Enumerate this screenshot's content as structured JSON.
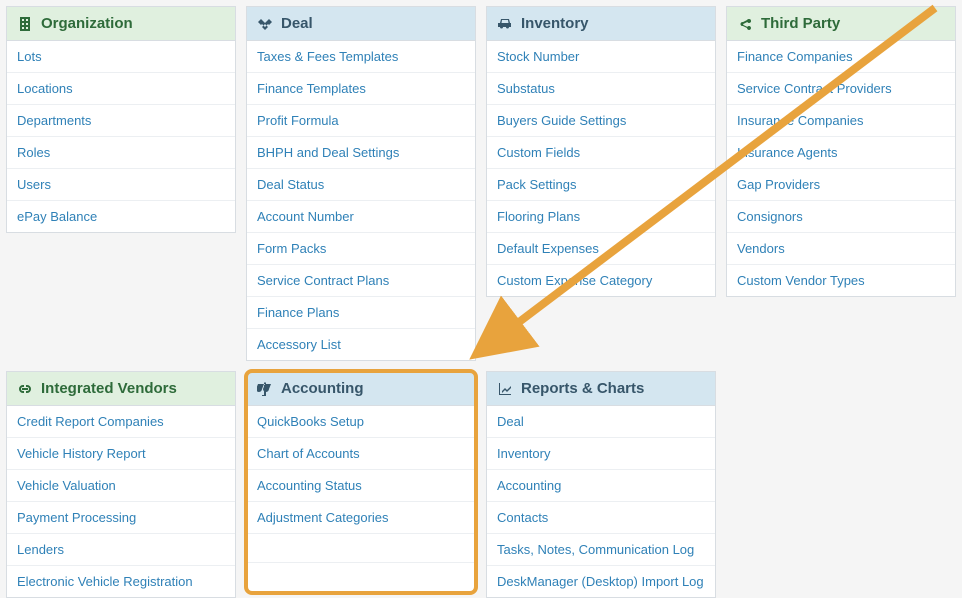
{
  "panels": {
    "organization": {
      "title": "Organization",
      "items": [
        "Lots",
        "Locations",
        "Departments",
        "Roles",
        "Users",
        "ePay Balance"
      ]
    },
    "deal": {
      "title": "Deal",
      "items": [
        "Taxes & Fees Templates",
        "Finance Templates",
        "Profit Formula",
        "BHPH and Deal Settings",
        "Deal Status",
        "Account Number",
        "Form Packs",
        "Service Contract Plans",
        "Finance Plans",
        "Accessory List"
      ]
    },
    "inventory": {
      "title": "Inventory",
      "items": [
        "Stock Number",
        "Substatus",
        "Buyers Guide Settings",
        "Custom Fields",
        "Pack Settings",
        "Flooring Plans",
        "Default Expenses",
        "Custom Expense Category"
      ]
    },
    "thirdparty": {
      "title": "Third Party",
      "items": [
        "Finance Companies",
        "Service Contract Providers",
        "Insurance Companies",
        "Insurance Agents",
        "Gap Providers",
        "Consignors",
        "Vendors",
        "Custom Vendor Types"
      ]
    },
    "integrated": {
      "title": "Integrated Vendors",
      "items": [
        "Credit Report Companies",
        "Vehicle History Report",
        "Vehicle Valuation",
        "Payment Processing",
        "Lenders",
        "Electronic Vehicle Registration"
      ]
    },
    "accounting": {
      "title": "Accounting",
      "items": [
        "QuickBooks Setup",
        "Chart of Accounts",
        "Accounting Status",
        "Adjustment Categories"
      ]
    },
    "reports": {
      "title": "Reports & Charts",
      "items": [
        "Deal",
        "Inventory",
        "Accounting",
        "Contacts",
        "Tasks, Notes, Communication Log",
        "DeskManager (Desktop) Import Log"
      ]
    }
  }
}
